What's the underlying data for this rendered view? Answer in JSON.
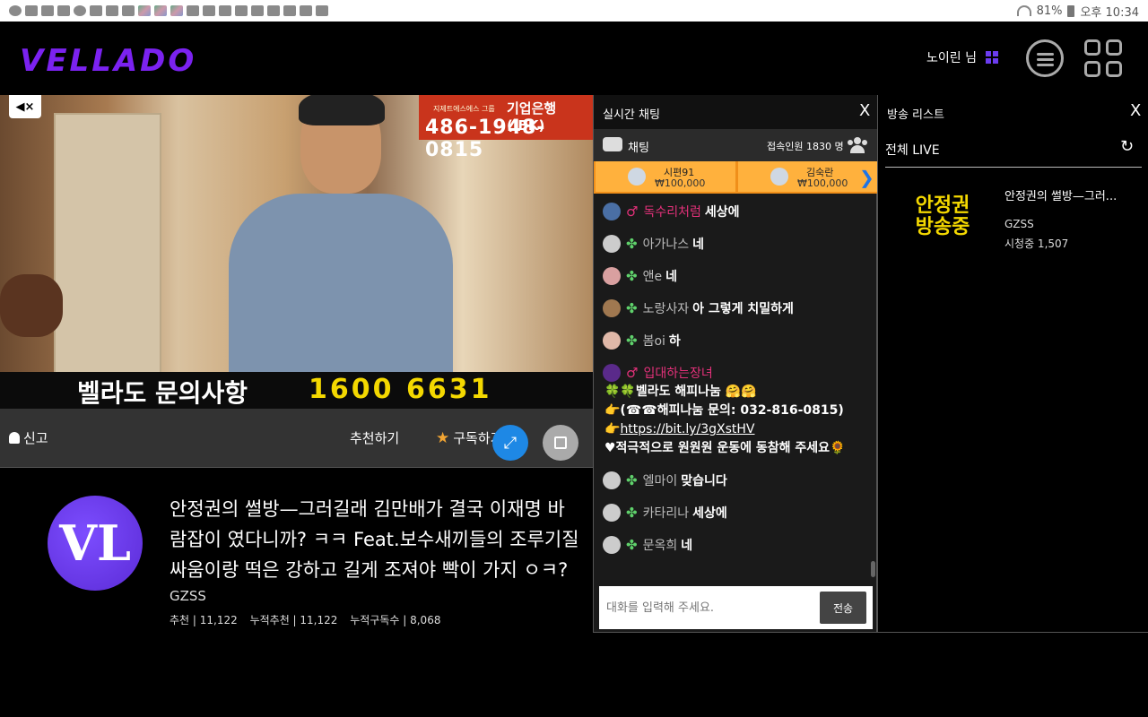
{
  "statusbar": {
    "battery": "81%",
    "time": "오후 10:34"
  },
  "header": {
    "logo": "VELLADO",
    "username": "노이린 님"
  },
  "video": {
    "ad_bank": "기업은행(IBK)",
    "ad_company": "지제트에스에스 그룹",
    "ad_number": "486-1948-0815",
    "banner_text": "벨라도 문의사항",
    "banner_number": "1600 6631"
  },
  "actions": {
    "report": "신고",
    "recommend": "추천하기",
    "subscribe": "구독하기"
  },
  "info": {
    "title": "안정권의 썰방—그러길래 김만배가 결국 이재명 바람잡이 였다니까? ㅋㅋ Feat.보수새끼들의 조루기질 싸움이랑 떡은 강하고 길게 조져야 빡이 가지 ㅇㅋ?",
    "channel": "GZSS",
    "stats": [
      "추천 | 11,122",
      "누적추천 | 11,122",
      "누적구독수 | 8,068"
    ]
  },
  "chat": {
    "title": "실시간 채팅",
    "close": "X",
    "tab": "채팅",
    "viewers": "접속인원 1830 명",
    "donors": [
      {
        "name": "시편91",
        "amount": "₩100,000"
      },
      {
        "name": "김숙란",
        "amount": "₩100,000"
      }
    ],
    "messages": [
      {
        "nick": "독수리처럼",
        "text": "세상에",
        "badge": "pink"
      },
      {
        "nick": "아가나스",
        "text": "네",
        "badge": "clover"
      },
      {
        "nick": "앤e",
        "text": "네",
        "badge": "clover"
      },
      {
        "nick": "노랑사자",
        "text": "아 그렇게 치밀하게",
        "badge": "clover"
      },
      {
        "nick": "봄oi",
        "text": "하",
        "badge": "clover"
      },
      {
        "nick": "입대하는장녀",
        "text": "",
        "badge": "pink"
      },
      {
        "nick": "엘마이",
        "text": "맞습니다",
        "badge": "clover"
      },
      {
        "nick": "카타리나",
        "text": "세상에",
        "badge": "clover"
      },
      {
        "nick": "문옥희",
        "text": "네",
        "badge": "clover"
      }
    ],
    "multiline": {
      "line1": "🍀🍀벨라도 해피나눔 🤗🤗",
      "line2": "👉(☎☎해피나눔 문의: 032-816-0815)",
      "line3_prefix": "👉",
      "line3_link": "https://bit.ly/3gXstHV",
      "line4": "♥적극적으로 원원원 운동에 동참해 주세요🌻"
    },
    "input_placeholder": "대화를 입력해 주세요.",
    "send": "전송"
  },
  "broadcast_list": {
    "title": "방송 리스트",
    "close": "X",
    "section": "전체 LIVE",
    "item": {
      "thumb_line1": "안정권",
      "thumb_line2": "방송중",
      "title": "안정권의 썰방—그러...",
      "channel": "GZSS",
      "viewers": "시청중 1,507"
    }
  }
}
